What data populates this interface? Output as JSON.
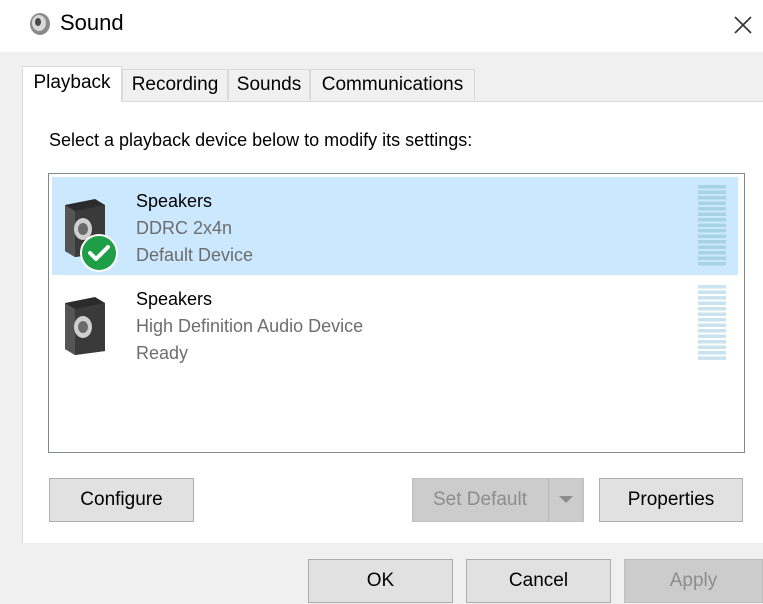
{
  "window": {
    "title": "Sound",
    "icon": "speaker-icon",
    "close_icon": "close-icon"
  },
  "tabs": [
    {
      "label": "Playback",
      "active": true
    },
    {
      "label": "Recording",
      "active": false
    },
    {
      "label": "Sounds",
      "active": false
    },
    {
      "label": "Communications",
      "active": false
    }
  ],
  "instruction": "Select a playback device below to modify its settings:",
  "devices": [
    {
      "name": "Speakers",
      "description": "DDRC 2x4n",
      "status": "Default Device",
      "selected": true,
      "default_badge": "check-icon"
    },
    {
      "name": "Speakers",
      "description": "High Definition Audio Device",
      "status": "Ready",
      "selected": false
    }
  ],
  "panel_buttons": {
    "configure": "Configure",
    "set_default": "Set Default",
    "properties": "Properties"
  },
  "footer_buttons": {
    "ok": "OK",
    "cancel": "Cancel",
    "apply": "Apply"
  },
  "colors": {
    "selection": "#cce8ff",
    "check_badge": "#1e9e47",
    "meter": "#a7d3e6"
  }
}
